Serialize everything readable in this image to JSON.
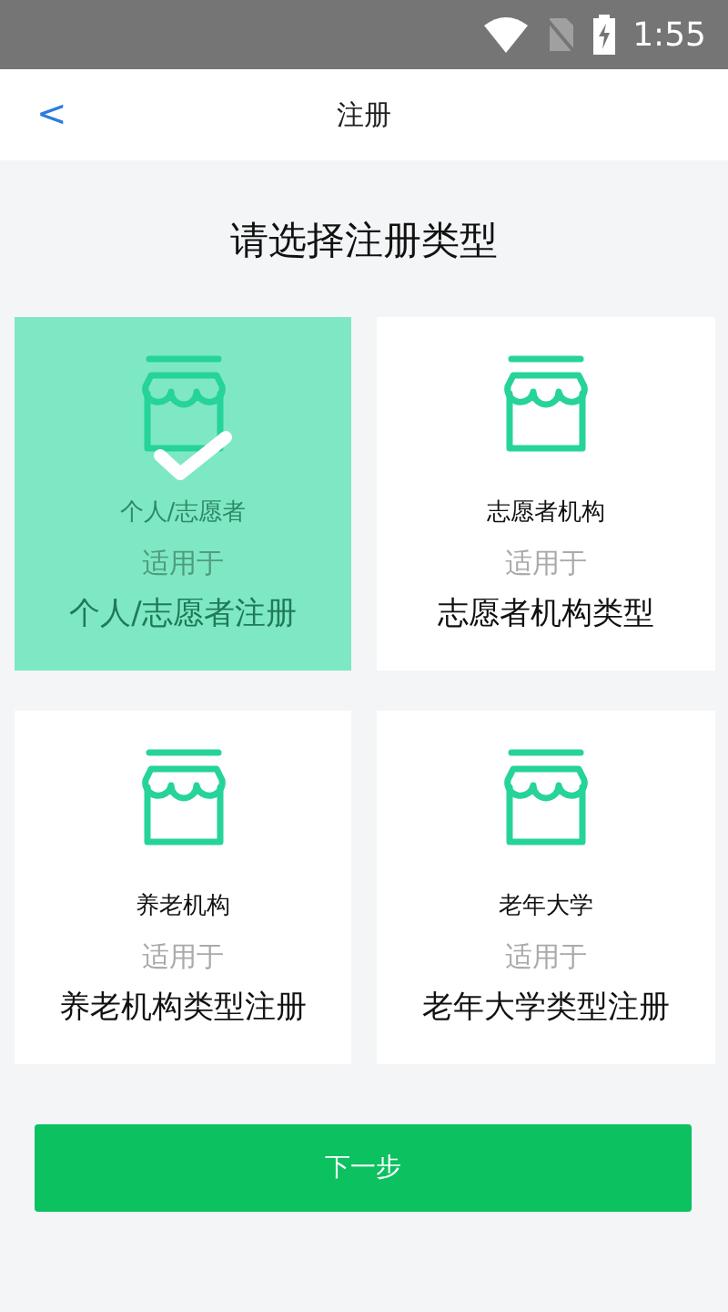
{
  "status_bar": {
    "time": "1:55"
  },
  "header": {
    "back": "<",
    "title": "注册"
  },
  "heading": "请选择注册类型",
  "types": [
    {
      "name": "个人/志愿者",
      "hint": "适用于",
      "desc": "个人/志愿者注册",
      "selected": true
    },
    {
      "name": "志愿者机构",
      "hint": "适用于",
      "desc": "志愿者机构类型",
      "selected": false
    },
    {
      "name": "养老机构",
      "hint": "适用于",
      "desc": "养老机构类型注册",
      "selected": false
    },
    {
      "name": "老年大学",
      "hint": "适用于",
      "desc": "老年大学类型注册",
      "selected": false
    }
  ],
  "next_button": "下一步"
}
